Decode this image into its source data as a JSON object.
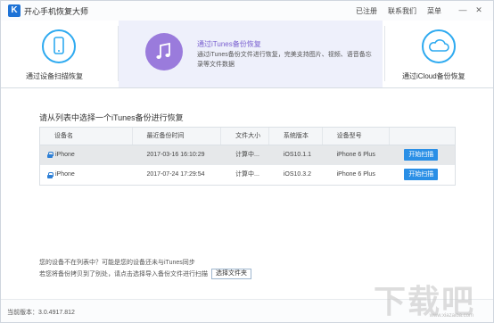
{
  "app": {
    "title": "开心手机恢复大师",
    "logo_letter": "K"
  },
  "top_links": {
    "register": "已注册",
    "contact": "联系我们",
    "menu": "菜单"
  },
  "window_controls": {
    "minimize": "—",
    "close": "✕"
  },
  "modes": {
    "device_scan": {
      "label": "通过设备扫描恢复",
      "icon": "phone-icon"
    },
    "itunes": {
      "title": "通过iTunes备份恢复",
      "desc": "通过iTunes备份文件进行恢复，完美支持图片、视频、语音备忘录等文件数据",
      "icon": "music-note-icon"
    },
    "icloud": {
      "label": "通过iCloud备份恢复",
      "icon": "cloud-icon"
    }
  },
  "backup_list": {
    "title": "请从列表中选择一个iTunes备份进行恢复",
    "columns": [
      "设备名",
      "最近备份时间",
      "文件大小",
      "系统版本",
      "设备型号",
      ""
    ],
    "rows": [
      {
        "name": "iPhone",
        "time": "2017-03-16 16:10:29",
        "size": "计算中...",
        "version": "iOS10.1.1",
        "model": "iPhone 6 Plus",
        "action": "开始扫描"
      },
      {
        "name": "iPhone",
        "time": "2017-07-24 17:29:54",
        "size": "计算中...",
        "version": "iOS10.3.2",
        "model": "iPhone 6 Plus",
        "action": "开始扫描"
      }
    ]
  },
  "help": {
    "line1": "您的设备不在列表中？可能是您的设备还未与iTunes同步",
    "line2": "若您将备份拷贝到了别处，请点击选择导入备份文件进行扫描",
    "choose_folder": "选择文件夹"
  },
  "footer": {
    "version": "当前版本：3.0.4917.812"
  },
  "watermark": {
    "text": "下载吧",
    "sub": "www.xiazaiba.com"
  },
  "colors": {
    "accent_blue": "#2a8fe6",
    "itunes_purple": "#9a7bdc",
    "outline_blue": "#2eaaf0"
  }
}
